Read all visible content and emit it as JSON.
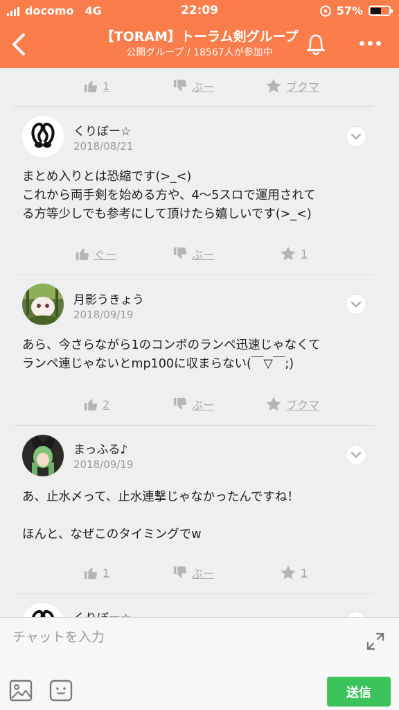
{
  "status_bar": {
    "carrier": "docomo",
    "network": "4G",
    "time": "22:09",
    "battery_percent": "57%",
    "battery_level": 0.57
  },
  "header": {
    "title": "【TORAM】トーラム剣グループ",
    "subtitle": "公開グループ / 18567人が参加中",
    "bg_color": "#fb7d4c"
  },
  "top_actions": {
    "like": "1",
    "dislike": "ぶー",
    "bookmark": "ブクマ"
  },
  "posts": [
    {
      "author": "くりぼー☆",
      "date": "2018/08/21",
      "lines": [
        "まとめ入りとは恐縮です(>_<)",
        "これから両手剣を始める方や、4〜5スロで運用されて",
        "る方等少しでも参考にして頂けたら嬉しいです(>_<)"
      ],
      "actions": {
        "like": "ぐー",
        "dislike": "ぶー",
        "bookmark": "1"
      }
    },
    {
      "author": "月影うきょう",
      "date": "2018/09/19",
      "lines": [
        "あら、今さらながら1のコンボのランペ迅速じゃなくて",
        "ランペ連じゃないとmp100に収まらない(￣▽￣;)"
      ],
      "actions": {
        "like": "2",
        "dislike": "ぶー",
        "bookmark": "ブクマ"
      }
    },
    {
      "author": "まっふる♪",
      "date": "2018/09/19",
      "lines": [
        "あ、止水〆って、止水連撃じゃなかったんですね！",
        "",
        "ほんと、なぜこのタイミングでw"
      ],
      "actions": {
        "like": "1",
        "dislike": "ぶー",
        "bookmark": "1"
      }
    },
    {
      "author": "くりぼー☆"
    }
  ],
  "input_bar": {
    "placeholder": "チャットを入力",
    "send_label": "送信",
    "send_color": "#3dc35c"
  }
}
